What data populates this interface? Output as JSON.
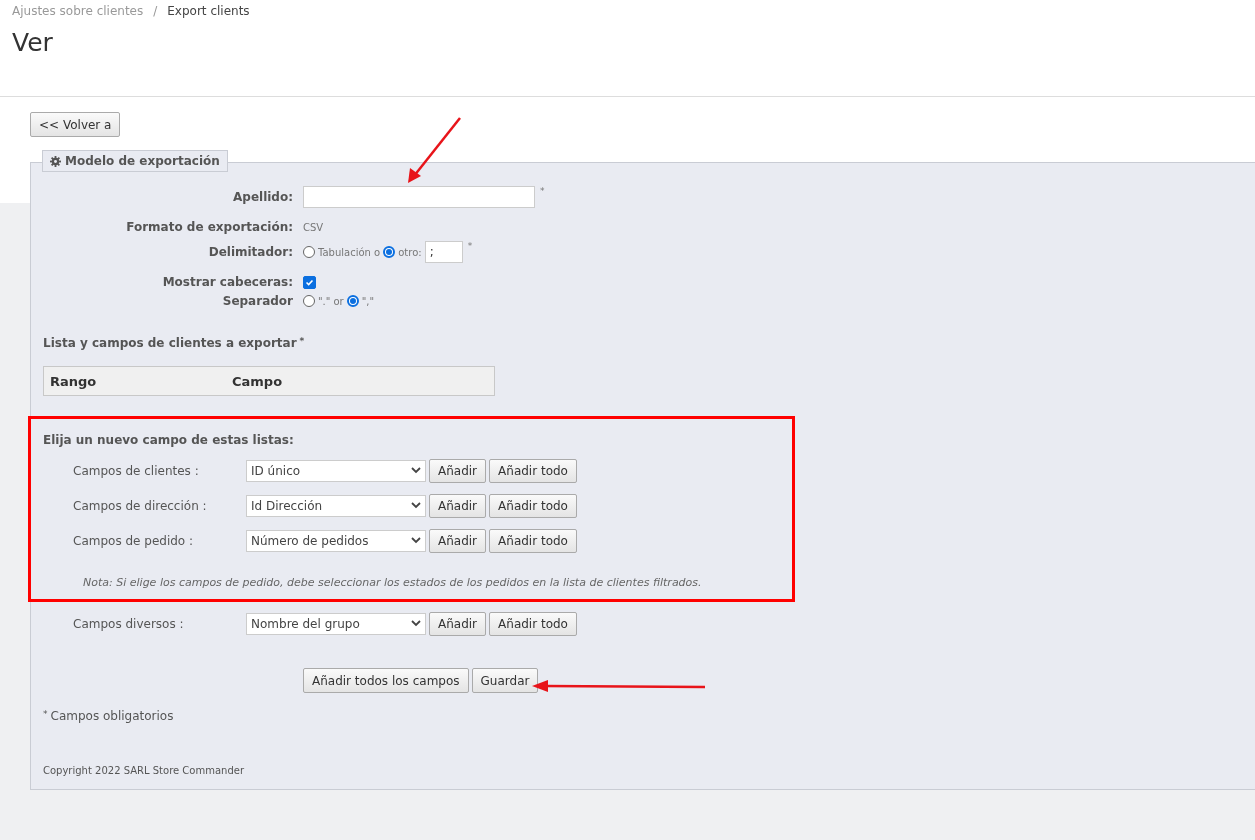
{
  "breadcrumb": {
    "parent": "Ajustes sobre clientes",
    "separator": "/",
    "current": "Export clients"
  },
  "title": "Ver",
  "back_button": "<< Volver a",
  "panel": {
    "legend": "Modelo de exportación",
    "name_field": {
      "label": "Apellido:",
      "required_mark": "*"
    },
    "format": {
      "label": "Formato de exportación:",
      "value": "CSV"
    },
    "delimiter": {
      "label": "Delimitador:",
      "options": [
        {
          "label": "Tabulación o",
          "selected": false
        },
        {
          "label": "otro:",
          "selected": true
        }
      ],
      "value": ";",
      "required_mark": "*"
    },
    "headers": {
      "label": "Mostrar cabeceras:",
      "checked": true
    },
    "separator": {
      "label": "Separador",
      "options": [
        {
          "label": "\".\"",
          "selected": false
        },
        {
          "label": "\",\"",
          "selected": true
        }
      ],
      "joiner": "or"
    },
    "list_heading": "Lista y campos de clientes a exportar",
    "list_required_mark": "*",
    "table": {
      "columns": [
        "Rango",
        "Campo"
      ]
    },
    "chooser": {
      "heading": "Elija un nuevo campo de estas listas:",
      "highlighted": true,
      "rows": [
        {
          "label": "Campos de clientes :",
          "value": "ID único",
          "add": "Añadir",
          "add_all": "Añadir todo"
        },
        {
          "label": "Campos de dirección :",
          "value": "Id Dirección",
          "add": "Añadir",
          "add_all": "Añadir todo"
        },
        {
          "label": "Campos de pedido :",
          "value": "Número de pedidos",
          "add": "Añadir",
          "add_all": "Añadir todo"
        }
      ],
      "note": "Nota: Si elige los campos de pedido, debe seleccionar los estados de los pedidos en la lista de clientes filtrados."
    },
    "misc_row": {
      "label": "Campos diversos :",
      "value": "Nombre del grupo",
      "add": "Añadir",
      "add_all": "Añadir todo"
    },
    "actions": [
      "Añadir todos los campos",
      "Guardar"
    ],
    "required_note": {
      "mark": "*",
      "text": "Campos obligatorios"
    },
    "copyright": "Copyright 2022 SARL Store Commander"
  }
}
